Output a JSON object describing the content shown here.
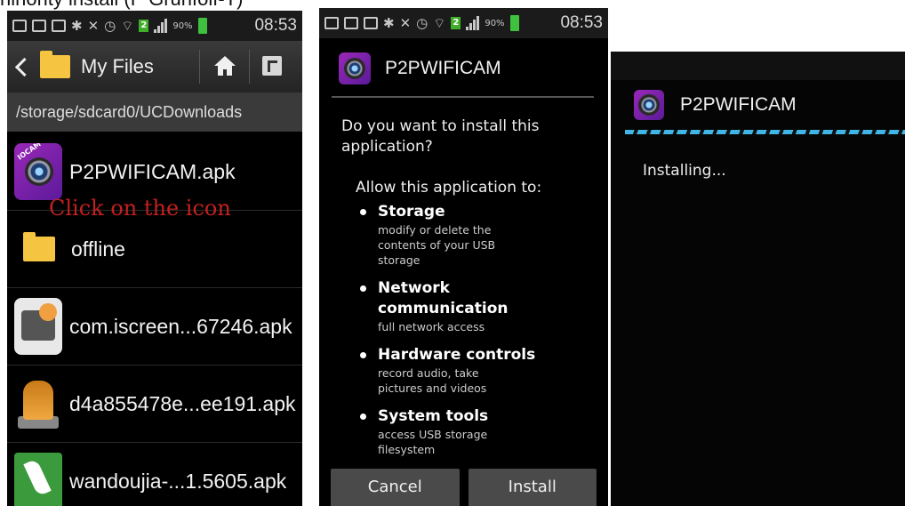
{
  "caption": "ninority install (P Grunfolf-T)",
  "status_bar": {
    "battery": "90%",
    "badge": "2",
    "time": "08:53"
  },
  "file_manager": {
    "title": "My Files",
    "path": "/storage/sdcard0/UCDownloads",
    "annotation": "Click on the icon",
    "files": [
      {
        "name": "P2PWIFICAM.apk",
        "icon": "p2pwificam-app-icon",
        "thumb_label": "IOCAM"
      },
      {
        "name": "offline",
        "icon": "folder-icon"
      },
      {
        "name": "com.iscreen...67246.apk",
        "icon": "iscreen-app-icon"
      },
      {
        "name": "d4a855478e...ee191.apk",
        "icon": "pawn-app-icon"
      },
      {
        "name": "wandoujia-...1.5605.apk",
        "icon": "wandoujia-app-icon"
      }
    ]
  },
  "install_dialog": {
    "app_name": "P2PWIFICAM",
    "question": "Do you want to install this application?",
    "allow_heading": "Allow this application to:",
    "permissions": [
      {
        "title": "Storage",
        "desc": "modify or delete the contents of your USB storage"
      },
      {
        "title": "Network communication",
        "desc": "full network access"
      },
      {
        "title": "Hardware controls",
        "desc": "record audio, take pictures and videos"
      },
      {
        "title": "System tools",
        "desc": "access USB storage filesystem"
      }
    ],
    "cancel_label": "Cancel",
    "install_label": "Install"
  },
  "installing_screen": {
    "app_name": "P2PWIFICAM",
    "status": "Installing..."
  },
  "colors": {
    "accent_progress": "#3fb6e6",
    "annotation_red": "#c4201f",
    "folder_yellow": "#f5c542"
  }
}
